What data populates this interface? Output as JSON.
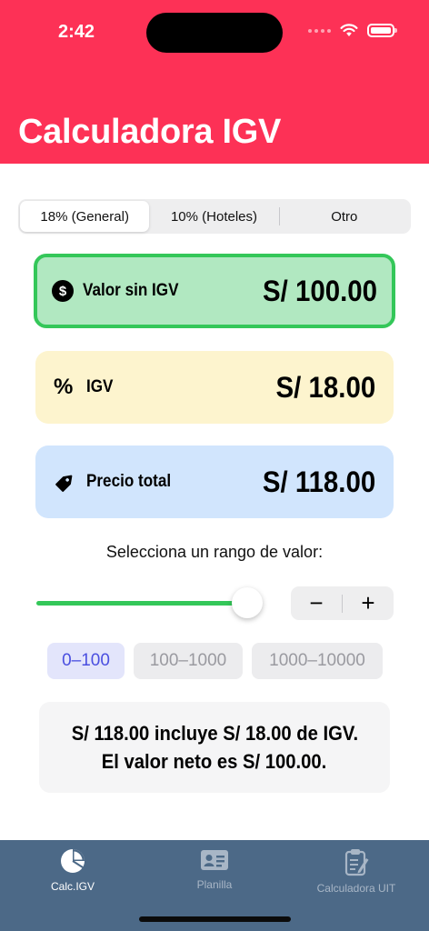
{
  "status_bar": {
    "time": "2:42"
  },
  "header": {
    "title": "Calculadora IGV"
  },
  "rate_selector": {
    "options": [
      "18% (General)",
      "10% (Hoteles)",
      "Otro"
    ],
    "selected_index": 0
  },
  "cards": {
    "value": {
      "icon": "dollar-circle-icon",
      "label": "Valor sin IGV",
      "amount": "S/ 100.00"
    },
    "igv": {
      "icon": "percent-icon",
      "symbol": "%",
      "label": "IGV",
      "amount": "S/ 18.00"
    },
    "total": {
      "icon": "tag-icon",
      "label": "Precio total",
      "amount": "S/ 118.00"
    }
  },
  "range": {
    "label": "Selecciona un rango de valor:",
    "slider_value": 100,
    "slider_min": 0,
    "slider_max": 100,
    "stepper": {
      "minus": "−",
      "plus": "+"
    },
    "chips": [
      "0–100",
      "100–1000",
      "1000–10000"
    ],
    "selected_chip": 0
  },
  "summary": {
    "line1": "S/ 118.00 incluye S/ 18.00 de IGV.",
    "line2": "El valor neto es S/ 100.00."
  },
  "tabbar": {
    "items": [
      {
        "label": "Calc.IGV",
        "icon": "pie-chart-icon",
        "active": true
      },
      {
        "label": "Planilla",
        "icon": "id-card-icon",
        "active": false
      },
      {
        "label": "Calculadora UIT",
        "icon": "clipboard-icon",
        "active": false
      }
    ]
  },
  "colors": {
    "header": "#fd3156",
    "accent_green": "#34c759",
    "tabbar": "#4c6987"
  }
}
